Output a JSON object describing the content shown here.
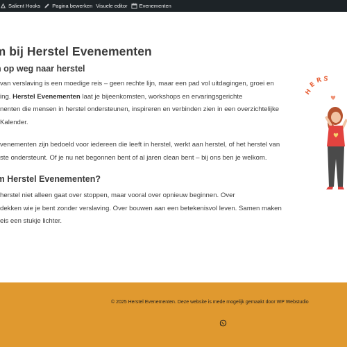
{
  "admin_bar": {
    "items": [
      {
        "label": "Salient Hooks",
        "icon": "salient-icon"
      },
      {
        "label": "Pagina bewerken",
        "icon": "pencil-icon"
      },
      {
        "label": "Visuele editor",
        "icon": ""
      },
      {
        "label": "Evenementen",
        "icon": "calendar-icon"
      }
    ]
  },
  "page": {
    "title": "kom bij Herstel Evenementen",
    "subtitle": "n op weg naar herstel",
    "p1": {
      "line1": "van verslaving is een moedige reis – geen rechte lijn, maar een pad vol uitdagingen, groei en",
      "line2_prefix": "ing. ",
      "line2_bold": "Herstel Evenementen",
      "line2_suffix": " laat je bijeenkomsten, workshops en ervaringsgerichte",
      "line3": "nenten die mensen in herstel ondersteunen, inspireren en verbinden zien in een overzichtelijke",
      "line4": "Kalender."
    },
    "p2": {
      "line1": "venementen zijn bedoeld voor iedereen die leeft in herstel, werkt aan herstel, of het herstel van",
      "line2": "ste ondersteunt. Of je nu net begonnen bent of al jaren clean bent – bij ons ben je welkom."
    },
    "heading2": "om Herstel Evenementen?",
    "p3": {
      "line1": "herstel niet alleen gaat over stoppen, maar vooral over opnieuw beginnen. Over",
      "line2": "dekken wie je bent zonder verslaving. Over bouwen aan een betekenisvol leven. Samen maken",
      "line3": "eis een stukje lichter."
    },
    "illustration_text": "HERS",
    "illustration": "woman-illustration"
  },
  "footer": {
    "copyright": "© 2025 Herstel Evenementen. Deze website is mede mogelijk gemaakt door WP Webstudio",
    "icon": "whatsapp-icon",
    "background": "#e0992f"
  },
  "colors": {
    "admin_bar": "#1d2327",
    "text": "#3d3d3d",
    "accent_orange": "#e0992f"
  }
}
